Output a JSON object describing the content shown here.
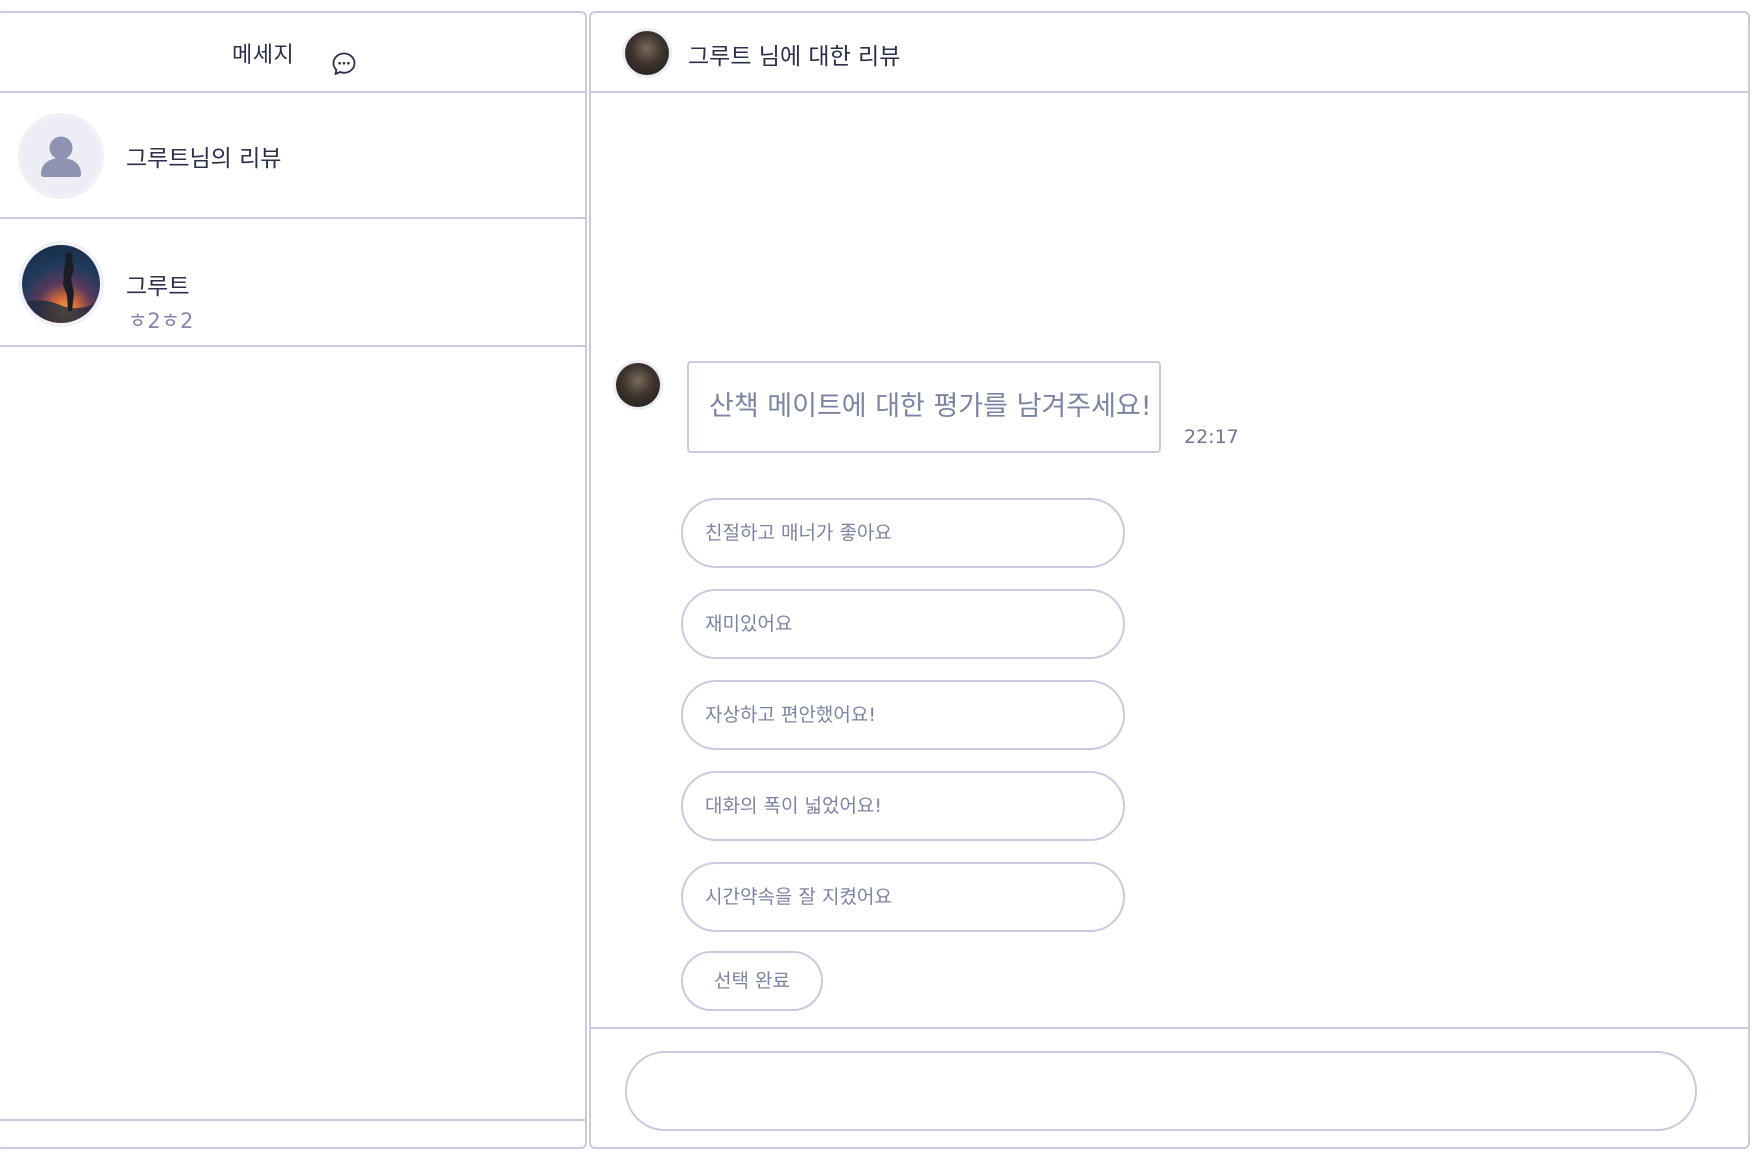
{
  "sidebar": {
    "title": "메세지",
    "title_icon": "chat-bubble-icon",
    "conversations": [
      {
        "name": "그루트님의 리뷰",
        "preview": "",
        "avatar": "default-user-avatar"
      },
      {
        "name": "그루트",
        "preview": "ㅎ2ㅎ2",
        "avatar": "user-photo-avatar"
      }
    ]
  },
  "chat": {
    "title": "그루트 님에 대한 리뷰",
    "message": {
      "text": "산책 메이트에 대한 평가를 남겨주세요!",
      "time": "22:17"
    },
    "options": [
      "친절하고 매너가 좋아요",
      "재미있어요",
      "자상하고 편안했어요!",
      "대화의 폭이 넓었어요!",
      "시간약속을 잘 지켰어요"
    ],
    "done_label": "선택 완료",
    "input": {
      "value": "",
      "placeholder": ""
    }
  },
  "colors": {
    "border": "#c7cbdd",
    "text_primary": "#2b2f4a",
    "text_muted": "#7d84a3"
  }
}
